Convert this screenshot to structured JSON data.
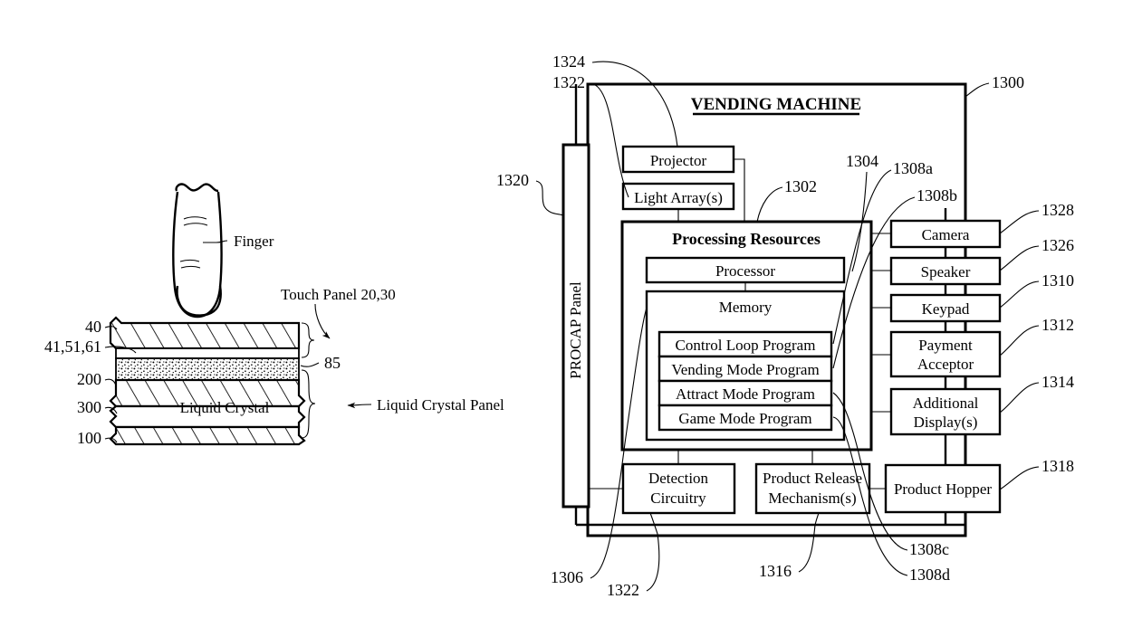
{
  "figure": {
    "left_diagram": {
      "finger_label": "Finger",
      "touch_panel_label": "Touch Panel 20,30",
      "lcd_panel_label": "Liquid Crystal Panel",
      "liquid_crystal_layer_label": "Liquid Crystal",
      "layer_refs": {
        "top_hatched": "40",
        "electrode_group": "41,51,61",
        "stipple_layer": "85",
        "upper_glass": "200",
        "lc_layer": "300",
        "lower_glass": "100"
      }
    },
    "right_diagram": {
      "title": "VENDING MACHINE",
      "outer_ref": "1300",
      "procap_panel": {
        "label": "PROCAP Panel",
        "ref": "1320"
      },
      "projector": {
        "label": "Projector",
        "ref": "1324"
      },
      "light_array": {
        "label": "Light Array(s)",
        "ref": "1322"
      },
      "processing_resources": {
        "label": "Processing Resources",
        "ref": "1302"
      },
      "processor": {
        "label": "Processor",
        "ref": "1304"
      },
      "memory": {
        "label": "Memory",
        "ref": "1306"
      },
      "programs": [
        {
          "label": "Control Loop Program",
          "ref": "1308a"
        },
        {
          "label": "Vending Mode Program",
          "ref": "1308b"
        },
        {
          "label": "Attract Mode Program",
          "ref": "1308c"
        },
        {
          "label": "Game Mode Program",
          "ref": "1308d"
        }
      ],
      "peripherals": [
        {
          "label": "Camera",
          "ref": "1328"
        },
        {
          "label": "Speaker",
          "ref": "1326"
        },
        {
          "label": "Keypad",
          "ref": "1310"
        },
        {
          "label_line1": "Payment",
          "label_line2": "Acceptor",
          "ref": "1312"
        },
        {
          "label_line1": "Additional",
          "label_line2": "Display(s)",
          "ref": "1314"
        },
        {
          "label": "Product Hopper",
          "ref": "1318"
        }
      ],
      "detection_circuitry": {
        "label_line1": "Detection",
        "label_line2": "Circuitry",
        "ref": "1322"
      },
      "product_release": {
        "label_line1": "Product Release",
        "label_line2": "Mechanism(s)",
        "ref": "1316"
      }
    }
  }
}
